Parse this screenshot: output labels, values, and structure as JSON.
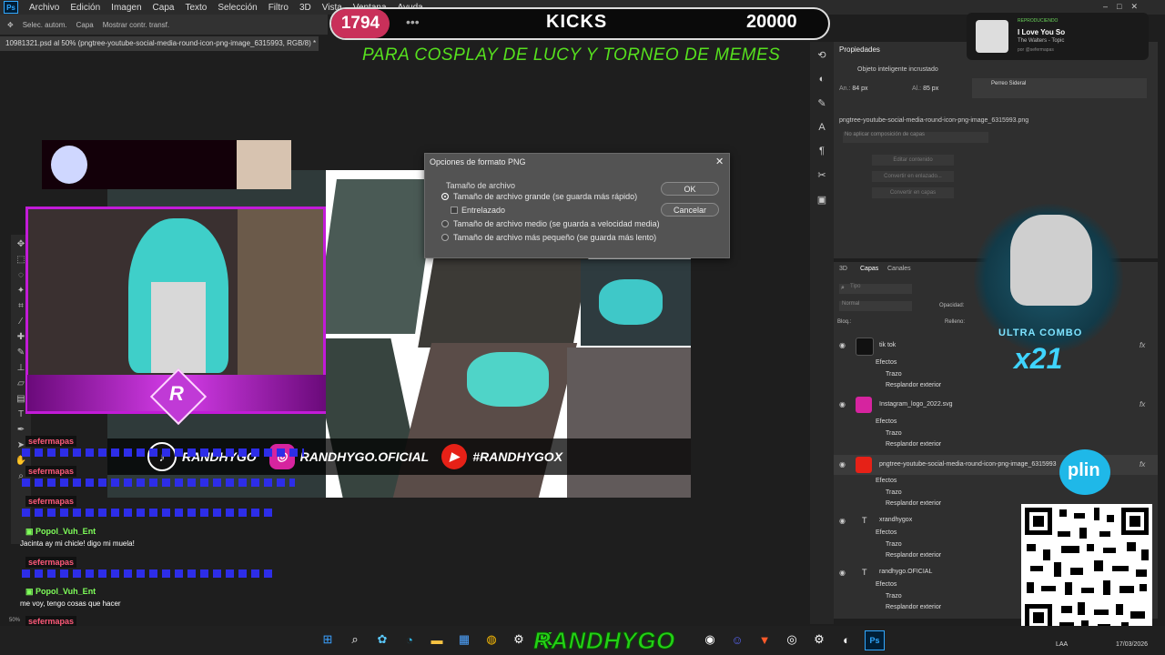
{
  "menu": {
    "app_icon": "Ps",
    "items": [
      "Archivo",
      "Edición",
      "Imagen",
      "Capa",
      "Texto",
      "Selección",
      "Filtro",
      "3D",
      "Vista",
      "Ventana",
      "Ayuda"
    ]
  },
  "options_bar": {
    "auto_select": "Selec. autom.",
    "target": "Capa",
    "transform": "Mostrar contr. transf."
  },
  "document_tab": "10981321.psd al 50% (pngtree-youtube-social-media-round-icon-png-image_6315993, RGB/8) *",
  "overlay": {
    "count_left": "1794",
    "center": "KICKS",
    "count_right": "20000",
    "banner": "PARA COSPLAY DE LUCY Y TORNEO DE MEMES"
  },
  "canvas": {
    "social": [
      {
        "icon": "tiktok-icon",
        "label": "RANDHYGO",
        "color": "#111111"
      },
      {
        "icon": "instagram-icon",
        "label": "RANDHYGO.OFICIAL",
        "color": "#d6249f"
      },
      {
        "icon": "youtube-icon",
        "label": "#RANDHYGOX",
        "color": "#e62117"
      }
    ]
  },
  "chat": {
    "messages": [
      {
        "user": "sefermapas",
        "text": ""
      },
      {
        "user": "sefermapas",
        "text": ""
      },
      {
        "user": "sefermapas",
        "text": ""
      },
      {
        "user": "Popol_Vuh_Ent",
        "text": "Jacinta ay mi chicle! digo mi muela!"
      },
      {
        "user": "sefermapas",
        "text": ""
      },
      {
        "user": "Popol_Vuh_Ent",
        "text": "me voy, tengo cosas que hacer"
      },
      {
        "user": "sefermapas",
        "text": ""
      }
    ]
  },
  "dialog": {
    "title": "Opciones de formato PNG",
    "group_label": "Tamaño de archivo",
    "options": [
      {
        "label": "Tamaño de archivo grande (se guarda más rápido)",
        "selected": true
      },
      {
        "label": "Tamaño de archivo medio (se guarda a velocidad media)",
        "selected": false
      },
      {
        "label": "Tamaño de archivo más pequeño (se guarda más lento)",
        "selected": false
      }
    ],
    "interlaced_label": "Entrelazado",
    "ok": "OK",
    "cancel": "Cancelar"
  },
  "properties": {
    "tab": "Propiedades",
    "object_type": "Objeto inteligente incrustado",
    "width_label": "An.:",
    "width_value": "84 px",
    "height_label": "Al.:",
    "height_value": "85 px",
    "filename": "pngtree-youtube-social-media-round-icon-png-image_6315993.png",
    "no_comp": "No aplicar composición de capas",
    "btn_edit": "Editar contenido",
    "btn_convert_linked": "Convertir en enlazado...",
    "btn_convert_layers": "Convertir en capas"
  },
  "layers_panel": {
    "tabs": [
      "3D",
      "Capas",
      "Canales"
    ],
    "search_placeholder": "Tipo",
    "blend_mode": "Normal",
    "opacity_label": "Opacidad:",
    "lock_label": "Bloq.:",
    "fill_label": "Relleno:",
    "effects_label": "Efectos",
    "stroke_label": "Trazo",
    "glow_label": "Resplandor exterior",
    "layers": [
      {
        "name": "tik tok",
        "kind": "smart",
        "color": "#111111"
      },
      {
        "name": "Instagram_logo_2022.svg",
        "kind": "smart",
        "color": "#d6249f"
      },
      {
        "name": "pngtree-youtube-social-media-round-icon-png-image_6315993",
        "kind": "smart",
        "color": "#e62117"
      },
      {
        "name": "xrandhygox",
        "kind": "text",
        "color": ""
      },
      {
        "name": "randhygo.OFICIAL",
        "kind": "text",
        "color": ""
      }
    ]
  },
  "notification": {
    "state": "REPRODUCIENDO",
    "title": "I Love You So",
    "artist": "The Walters - Topic",
    "by": "por @sefermapas"
  },
  "next_song": {
    "title": "Perreo Sideral"
  },
  "combo": {
    "label": "ULTRA COMBO",
    "count": "x21"
  },
  "plin": "plin",
  "status_bar": "50%",
  "taskbar": {
    "streamer_name": "RANDHYGO",
    "lang": "LAA",
    "date": "17/03/2026",
    "icons": [
      "windows-start-icon",
      "search-icon",
      "copilot-icon",
      "edge-icon",
      "folder-icon",
      "store-icon",
      "chrome-icon",
      "steam-icon",
      "kick-icon"
    ]
  },
  "colors": {
    "accent_magenta": "#c21bd8",
    "banner_green": "#56e01e",
    "kick_green": "#23d115",
    "counter_pink": "#c9305a"
  }
}
